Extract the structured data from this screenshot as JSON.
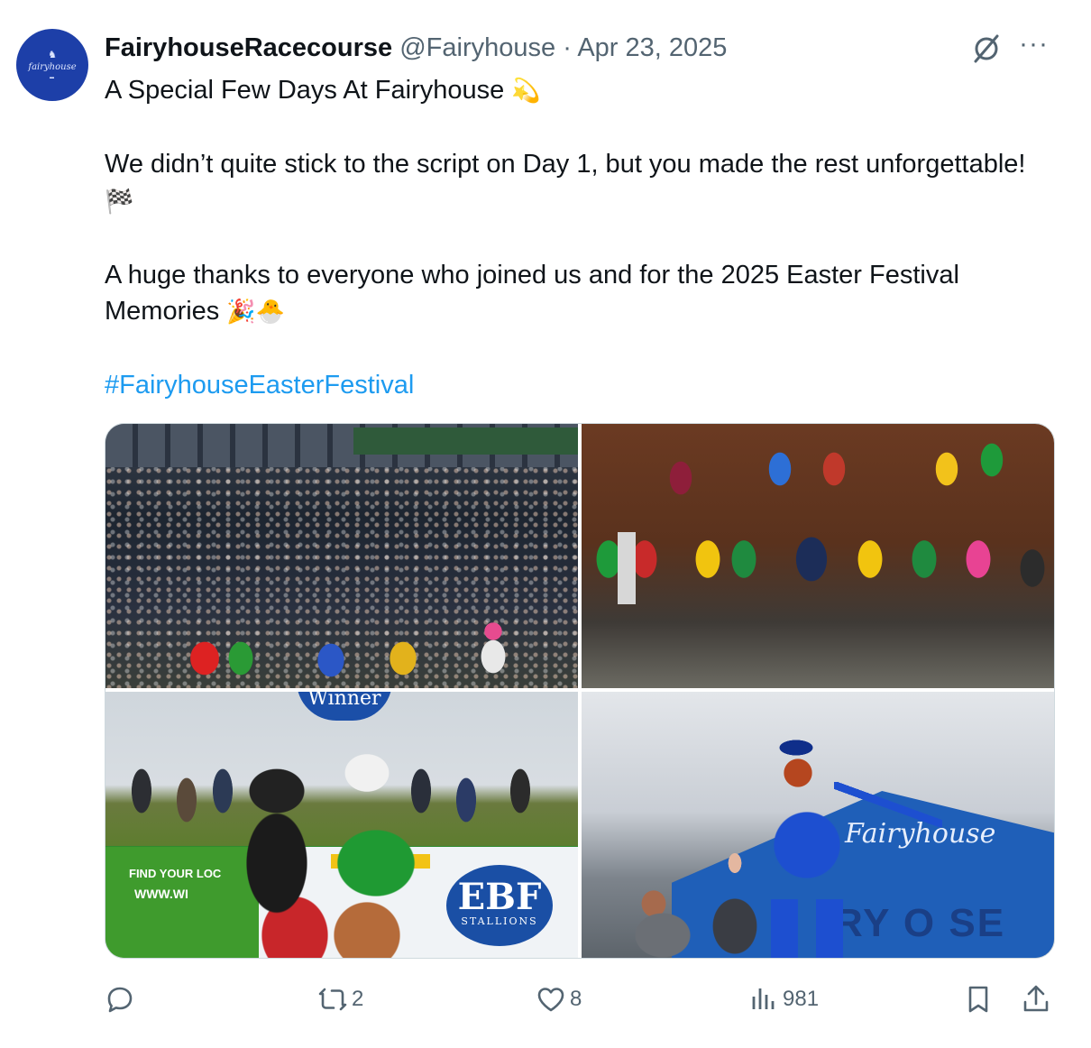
{
  "author": {
    "display_name": "FairyhouseRacecourse",
    "handle": "@Fairyhouse",
    "separator": "·",
    "date": "Apr 23, 2025",
    "avatar_text": "fairyhouse",
    "avatar_icon": "horse-icon"
  },
  "tweet": {
    "line1": "A Special Few Days At Fairyhouse",
    "line1_emoji": "💫",
    "para2": "We didn’t quite stick to the script on Day 1, but you made the rest unforgettable!",
    "para2_emoji": "🏁",
    "para3": "A huge thanks to everyone who joined us and for the 2025 Easter Festival Memories",
    "para3_emoji": "🎉🐣",
    "hashtag": "#FairyhouseEasterFestival"
  },
  "media": {
    "photo3_banner_line1": "FIND YOUR LOC",
    "photo3_banner_line2": "WWW.WI",
    "photo3_winner": "Winner",
    "photo3_ebf": "EBF",
    "photo3_ebf_sub": "STALLIONS",
    "photo4_tent_text": "Fairyhouse",
    "photo4_letters": "RY  O  SE"
  },
  "actions": {
    "reply_icon": "reply-icon",
    "retweet_count": "2",
    "like_count": "8",
    "views_count": "981",
    "bookmark_icon": "bookmark-icon",
    "share_icon": "share-icon"
  },
  "colors": {
    "link": "#1d9bf0",
    "muted": "#536471",
    "text": "#0f1419"
  }
}
